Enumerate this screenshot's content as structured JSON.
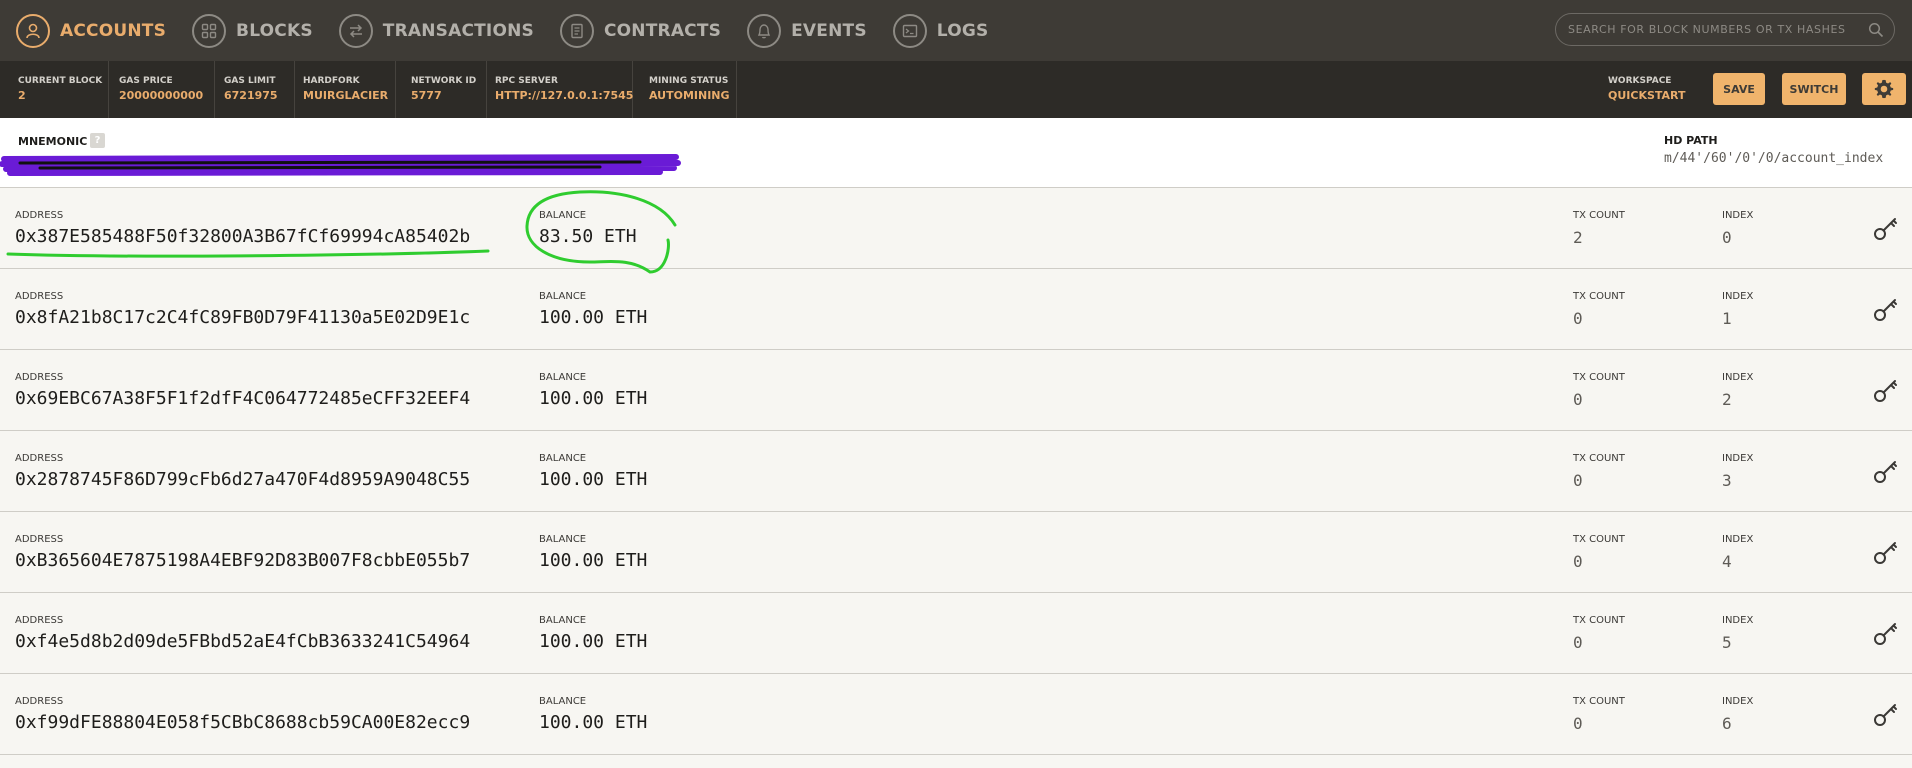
{
  "nav": {
    "items": [
      {
        "label": "ACCOUNTS",
        "icon": "user-icon",
        "active": true
      },
      {
        "label": "BLOCKS",
        "icon": "blocks-icon",
        "active": false
      },
      {
        "label": "TRANSACTIONS",
        "icon": "transfer-icon",
        "active": false
      },
      {
        "label": "CONTRACTS",
        "icon": "document-icon",
        "active": false
      },
      {
        "label": "EVENTS",
        "icon": "bell-icon",
        "active": false
      },
      {
        "label": "LOGS",
        "icon": "terminal-icon",
        "active": false
      }
    ],
    "search_placeholder": "SEARCH FOR BLOCK NUMBERS OR TX HASHES"
  },
  "status": {
    "current_block": {
      "label": "CURRENT BLOCK",
      "value": "2"
    },
    "gas_price": {
      "label": "GAS PRICE",
      "value": "20000000000"
    },
    "gas_limit": {
      "label": "GAS LIMIT",
      "value": "6721975"
    },
    "hardfork": {
      "label": "HARDFORK",
      "value": "MUIRGLACIER"
    },
    "network_id": {
      "label": "NETWORK ID",
      "value": "5777"
    },
    "rpc_server": {
      "label": "RPC SERVER",
      "value": "HTTP://127.0.0.1:7545"
    },
    "mining_status": {
      "label": "MINING STATUS",
      "value": "AUTOMINING"
    },
    "workspace": {
      "label": "WORKSPACE",
      "value": "QUICKSTART"
    },
    "save_label": "SAVE",
    "switch_label": "SWITCH"
  },
  "mnemonic": {
    "title": "MNEMONIC",
    "help": "?",
    "hd_path_label": "HD PATH",
    "hd_path": "m/44'/60'/0'/0/account_index"
  },
  "labels": {
    "address": "ADDRESS",
    "balance": "BALANCE",
    "tx_count": "TX COUNT",
    "index": "INDEX"
  },
  "accounts": [
    {
      "address": "0x387E585488F50f32800A3B67fCf69994cA85402b",
      "balance": "83.50 ETH",
      "tx_count": "2",
      "index": "0"
    },
    {
      "address": "0x8fA21b8C17c2C4fC89FB0D79F41130a5E02D9E1c",
      "balance": "100.00 ETH",
      "tx_count": "0",
      "index": "1"
    },
    {
      "address": "0x69EBC67A38F5F1f2dfF4C064772485eCFF32EEF4",
      "balance": "100.00 ETH",
      "tx_count": "0",
      "index": "2"
    },
    {
      "address": "0x2878745F86D799cFb6d27a470F4d8959A9048C55",
      "balance": "100.00 ETH",
      "tx_count": "0",
      "index": "3"
    },
    {
      "address": "0xB365604E7875198A4EBF92D83B007F8cbbE055b7",
      "balance": "100.00 ETH",
      "tx_count": "0",
      "index": "4"
    },
    {
      "address": "0xf4e5d8b2d09de5FBbd52aE4fCbB3633241C54964",
      "balance": "100.00 ETH",
      "tx_count": "0",
      "index": "5"
    },
    {
      "address": "0xf99dFE88804E058f5CBbC8688cb59CA00E82ecc9",
      "balance": "100.00 ETH",
      "tx_count": "0",
      "index": "6"
    }
  ],
  "colors": {
    "accent": "#e9ac6c",
    "nav_bg": "#3e3b36",
    "status_bg": "#2d2b27",
    "highlight_annotation": "#33cc33",
    "redaction": "#6a1bd6"
  }
}
